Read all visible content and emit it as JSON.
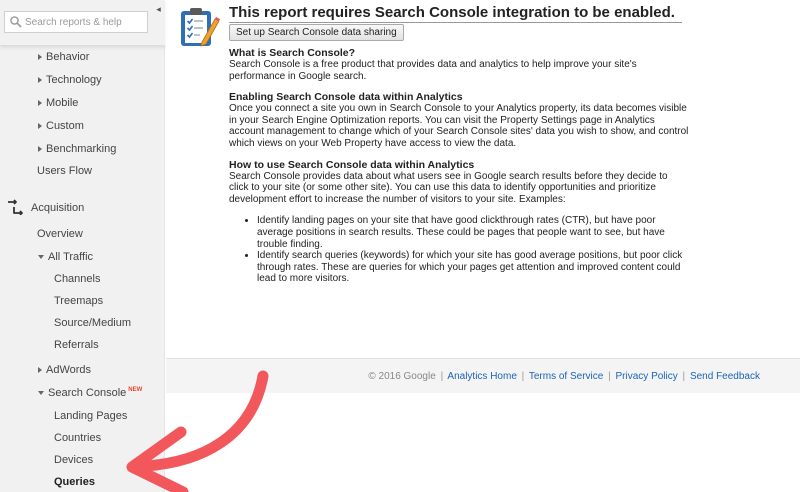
{
  "sidebar": {
    "search_placeholder": "Search reports & help",
    "collapse_glyph": "◂",
    "items": [
      {
        "label": "Behavior"
      },
      {
        "label": "Technology"
      },
      {
        "label": "Mobile"
      },
      {
        "label": "Custom"
      },
      {
        "label": "Benchmarking"
      },
      {
        "label": "Users Flow"
      },
      {
        "label": "Acquisition"
      },
      {
        "label": "Overview"
      },
      {
        "label": "All Traffic"
      },
      {
        "label": "Channels"
      },
      {
        "label": "Treemaps"
      },
      {
        "label": "Source/Medium"
      },
      {
        "label": "Referrals"
      },
      {
        "label": "AdWords"
      },
      {
        "label": "Search Console",
        "badge": "NEW"
      },
      {
        "label": "Landing Pages"
      },
      {
        "label": "Countries"
      },
      {
        "label": "Devices"
      },
      {
        "label": "Queries"
      }
    ]
  },
  "main": {
    "title": "This report requires Search Console integration to be enabled.",
    "setup_button": "Set up Search Console data sharing",
    "sections": [
      {
        "heading": "What is Search Console?",
        "body": "Search Console is a free product that provides data and analytics to help improve your site's performance in Google search."
      },
      {
        "heading": "Enabling Search Console data within Analytics",
        "body": "Once you connect a site you own in Search Console to your Analytics property, its data becomes visible in your Search Engine Optimization reports. You can visit the Property Settings page in Analytics account management to change which of your Search Console sites' data you wish to show, and control which views on your Web Property have access to view the data."
      },
      {
        "heading": "How to use Search Console data within Analytics",
        "body": "Search Console provides data about what users see in Google search results before they decide to click to your site (or some other site). You can use this data to identify opportunities and prioritize development effort to increase the number of visitors to your site. Examples:"
      }
    ],
    "bullets": [
      "Identify landing pages on your site that have good clickthrough rates (CTR), but have poor average positions in search results. These could be pages that people want to see, but have trouble finding.",
      "Identify search queries (keywords) for which your site has good average positions, but poor click through rates. These are queries for which your pages get attention and improved content could lead to more visitors."
    ]
  },
  "footer": {
    "copyright": "© 2016 Google",
    "separator": "|",
    "links": [
      "Analytics Home",
      "Terms of Service",
      "Privacy Policy",
      "Send Feedback"
    ]
  },
  "colors": {
    "arrow": "#f2585b",
    "link": "#1d63b5",
    "new_badge": "#e8452b"
  }
}
